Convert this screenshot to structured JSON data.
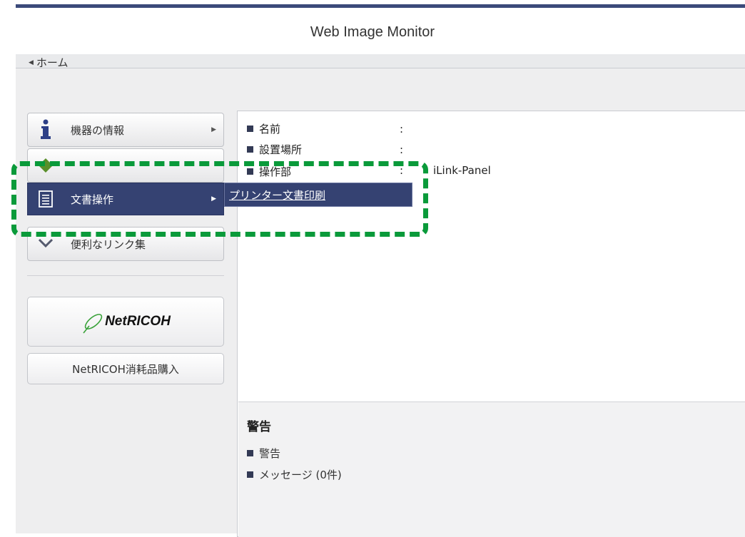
{
  "app": {
    "title": "Web Image Monitor"
  },
  "breadcrumb": {
    "home_label": "ホーム"
  },
  "sidebar": {
    "items": [
      {
        "label": "機器の情報",
        "icon": "info-icon"
      },
      {
        "label": "",
        "icon": "status-diamond-icon"
      },
      {
        "label": "文書操作",
        "icon": "document-icon"
      },
      {
        "label": "便利なリンク集",
        "icon": "chevron-double-icon"
      }
    ],
    "logo_text": "NetRICOH",
    "shop_label": "NetRICOH消耗品購入"
  },
  "submenu": {
    "label": "プリンター文書印刷"
  },
  "device_info": {
    "rows": [
      {
        "label": "名前",
        "colon": ":",
        "value": ""
      },
      {
        "label": "設置場所",
        "colon": ":",
        "value": ""
      },
      {
        "label": "操作部",
        "colon": ":",
        "value": "iLink-Panel"
      }
    ]
  },
  "warnings": {
    "title": "警告",
    "items": [
      "警告",
      "メッセージ (0件)"
    ]
  },
  "colors": {
    "accent": "#354272",
    "highlight": "#0a9a3a",
    "background": "#eeeeef"
  }
}
